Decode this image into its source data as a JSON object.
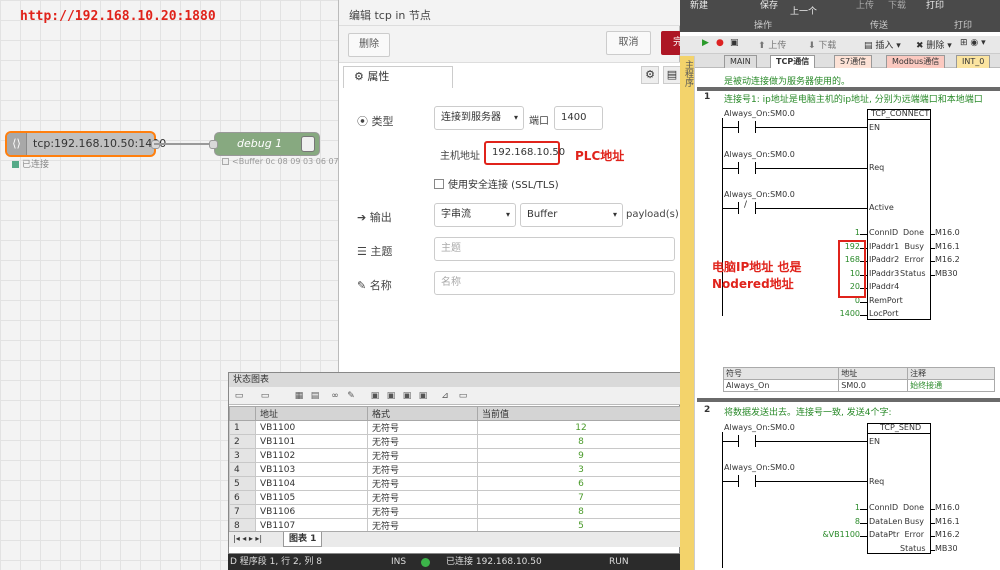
{
  "nodered": {
    "url": "http://192.168.10.20:1880",
    "tcp_node_label": "tcp:192.168.10.50:1400",
    "tcp_status": "已连接",
    "debug_node_label": "debug 1",
    "debug_status": "<Buffer 0c 08 09 03 06 07"
  },
  "tray": {
    "title": "编辑 tcp in 节点",
    "delete_label": "删除",
    "cancel_label": "取消",
    "done_label": "完",
    "tab_label": "属性",
    "type_label": "类型",
    "type_value": "连接到服务器",
    "port_label": "端口",
    "port_value": "1400",
    "host_label": "主机地址",
    "host_value": "192.168.10.50",
    "plc_annotation": "PLC地址",
    "ssl_label": "使用安全连接 (SSL/TLS)",
    "output_label": "输出",
    "output_value": "字串流",
    "output_type": "Buffer",
    "payload_label": "payload(s)",
    "topic_label": "主题",
    "topic_placeholder": "主题",
    "name_label": "名称",
    "name_placeholder": "名称"
  },
  "status_chart": {
    "title": "状态图表",
    "headers": [
      "地址",
      "格式",
      "当前值"
    ],
    "rows": [
      {
        "n": "1",
        "addr": "VB1100",
        "fmt": "无符号",
        "val": "12"
      },
      {
        "n": "2",
        "addr": "VB1101",
        "fmt": "无符号",
        "val": "8"
      },
      {
        "n": "3",
        "addr": "VB1102",
        "fmt": "无符号",
        "val": "9"
      },
      {
        "n": "4",
        "addr": "VB1103",
        "fmt": "无符号",
        "val": "3"
      },
      {
        "n": "5",
        "addr": "VB1104",
        "fmt": "无符号",
        "val": "6"
      },
      {
        "n": "6",
        "addr": "VB1105",
        "fmt": "无符号",
        "val": "7"
      },
      {
        "n": "7",
        "addr": "VB1106",
        "fmt": "无符号",
        "val": "8"
      },
      {
        "n": "8",
        "addr": "VB1107",
        "fmt": "无符号",
        "val": "5"
      }
    ],
    "tab_label": "图表 1"
  },
  "statusbar": {
    "position": "D 程序段 1, 行 2, 列 8",
    "mode": "INS",
    "connection": "已连接 192.168.10.50",
    "run": "RUN"
  },
  "microwin": {
    "ribbon": {
      "new": "新建",
      "save": "保存",
      "prev": "上一个",
      "up": "上传",
      "down": "下载",
      "print": "打印",
      "g_op": "操作",
      "g_transfer": "传送",
      "g_print": "打印"
    },
    "toolbar": {
      "upload": "上传",
      "download": "下载",
      "insert": "插入",
      "delete": "删除"
    },
    "tabs": [
      "MAIN",
      "TCP通信",
      "S7通信",
      "Modbus通信",
      "INT_0"
    ],
    "sidebar_label": "主程序",
    "header_comment": "是被动连接做为服务器使用的。",
    "net1": {
      "num": "1",
      "comment": "连接号1: ip地址是电脑主机的ip地址, 分别为远端端口和本地端口",
      "contact1": "Always_On:SM0.0",
      "contact2": "Always_On:SM0.0",
      "contact3": "Always_On:SM0.0",
      "block": "TCP_CONNECT",
      "en": "EN",
      "req": "Req",
      "active": "Active",
      "inputs": [
        "ConnID",
        "IPaddr1",
        "IPaddr2",
        "IPaddr3",
        "IPaddr4",
        "RemPort",
        "LocPort"
      ],
      "values": [
        "1",
        "192",
        "168",
        "10",
        "20",
        "0",
        "1400"
      ],
      "outputs": [
        "Done",
        "Busy",
        "Error",
        "Status"
      ],
      "out_values": [
        "M16.0",
        "M16.1",
        "M16.2",
        "MB30"
      ]
    },
    "pc_annotation": "电脑IP地址 也是 Nodered地址",
    "symtab": {
      "headers": [
        "符号",
        "地址",
        "注释"
      ],
      "row": [
        "Always_On",
        "SM0.0",
        "始终接通"
      ]
    },
    "net2": {
      "num": "2",
      "comment": "将数据发送出去。连接号一致, 发送4个字:",
      "contact1": "Always_On:SM0.0",
      "contact2": "Always_On:SM0.0",
      "block": "TCP_SEND",
      "en": "EN",
      "req": "Req",
      "inputs": [
        "ConnID",
        "DataLen",
        "DataPtr"
      ],
      "values": [
        "1",
        "8",
        "&VB1100"
      ],
      "outputs": [
        "Done",
        "Busy",
        "Error",
        "Status"
      ],
      "out_values": [
        "M16.0",
        "M16.1",
        "M16.2",
        "MB30"
      ]
    }
  }
}
